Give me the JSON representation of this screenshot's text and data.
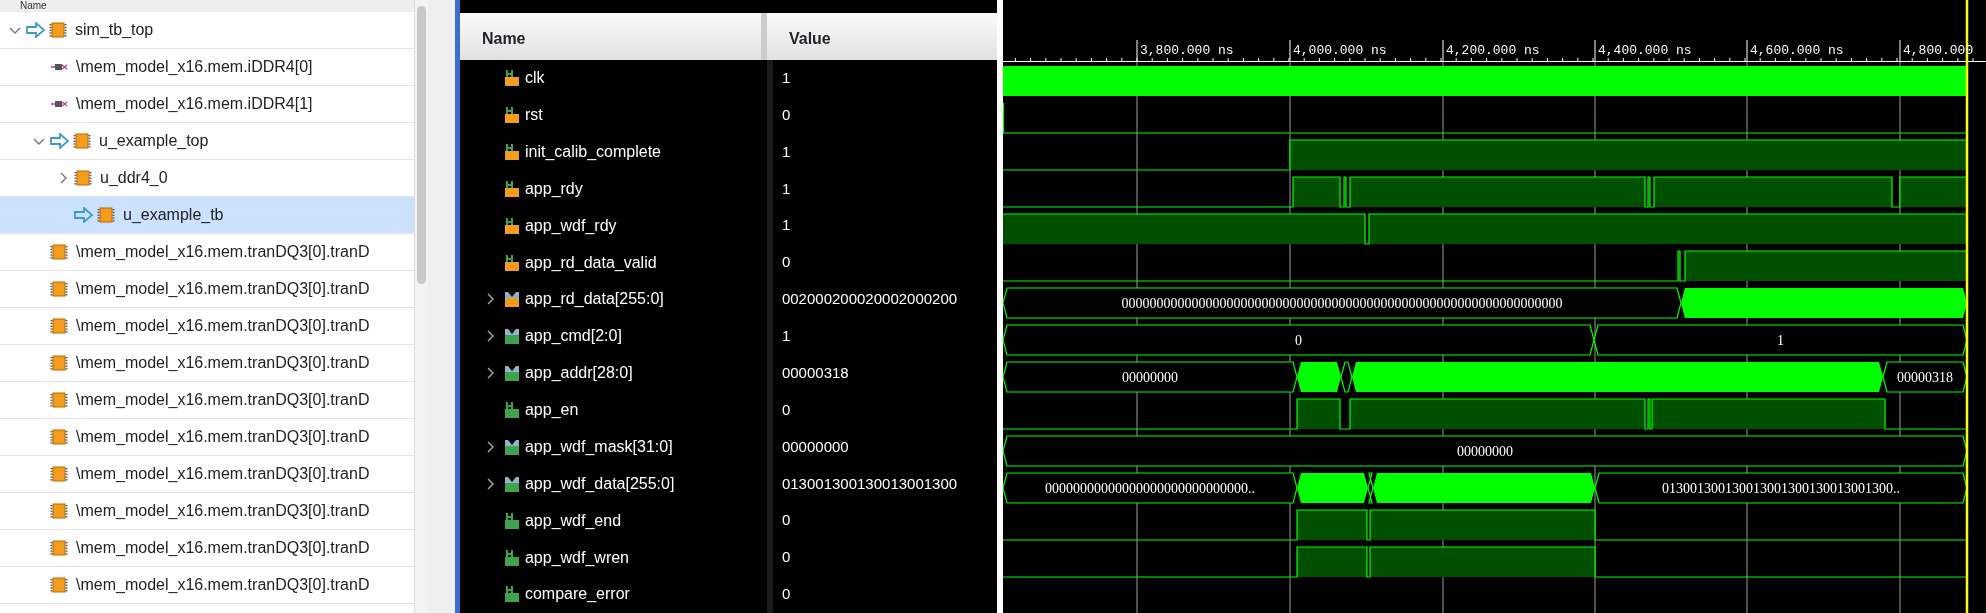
{
  "tree": {
    "header": "Name",
    "items": [
      {
        "label": "sim_tb_top",
        "kind": "module",
        "pointer": true,
        "expanded": true,
        "selected": false,
        "children": [
          {
            "label": "\\mem_model_x16.mem.iDDR4[0]",
            "kind": "primitive",
            "pointer": false,
            "selected": false
          },
          {
            "label": "\\mem_model_x16.mem.iDDR4[1]",
            "kind": "primitive",
            "pointer": false,
            "selected": false
          },
          {
            "label": "u_example_top",
            "kind": "module",
            "pointer": true,
            "expanded": true,
            "selected": false,
            "children": [
              {
                "label": "u_ddr4_0",
                "kind": "module",
                "pointer": false,
                "expanded": false,
                "selected": false
              },
              {
                "label": "u_example_tb",
                "kind": "module",
                "pointer": true,
                "selected": true
              }
            ]
          },
          {
            "label": "\\mem_model_x16.mem.tranDQ3[0].tranD",
            "kind": "module",
            "pointer": false,
            "selected": false
          },
          {
            "label": "\\mem_model_x16.mem.tranDQ3[0].tranD",
            "kind": "module",
            "pointer": false,
            "selected": false
          },
          {
            "label": "\\mem_model_x16.mem.tranDQ3[0].tranD",
            "kind": "module",
            "pointer": false,
            "selected": false
          },
          {
            "label": "\\mem_model_x16.mem.tranDQ3[0].tranD",
            "kind": "module",
            "pointer": false,
            "selected": false
          },
          {
            "label": "\\mem_model_x16.mem.tranDQ3[0].tranD",
            "kind": "module",
            "pointer": false,
            "selected": false
          },
          {
            "label": "\\mem_model_x16.mem.tranDQ3[0].tranD",
            "kind": "module",
            "pointer": false,
            "selected": false
          },
          {
            "label": "\\mem_model_x16.mem.tranDQ3[0].tranD",
            "kind": "module",
            "pointer": false,
            "selected": false
          },
          {
            "label": "\\mem_model_x16.mem.tranDQ3[0].tranD",
            "kind": "module",
            "pointer": false,
            "selected": false
          },
          {
            "label": "\\mem_model_x16.mem.tranDQ3[0].tranD",
            "kind": "module",
            "pointer": false,
            "selected": false
          },
          {
            "label": "\\mem_model_x16.mem.tranDQ3[0].tranD",
            "kind": "module",
            "pointer": false,
            "selected": false
          }
        ]
      }
    ]
  },
  "signals": {
    "columns": [
      "Name",
      "Value"
    ],
    "rows": [
      {
        "name": "clk",
        "value": "1",
        "kind": "bit",
        "color": "#f39c1e"
      },
      {
        "name": "rst",
        "value": "0",
        "kind": "bit",
        "color": "#f39c1e"
      },
      {
        "name": "init_calib_complete",
        "value": "1",
        "kind": "bit",
        "color": "#f39c1e"
      },
      {
        "name": "app_rdy",
        "value": "1",
        "kind": "bit",
        "color": "#f39c1e"
      },
      {
        "name": "app_wdf_rdy",
        "value": "1",
        "kind": "bit",
        "color": "#f39c1e"
      },
      {
        "name": "app_rd_data_valid",
        "value": "0",
        "kind": "bit",
        "color": "#f39c1e"
      },
      {
        "name": "app_rd_data[255:0]",
        "value": "002000200020002000200",
        "kind": "bus",
        "color": "#f39c1e",
        "expanded": false,
        "wave_labels": [
          "000000000000000000000000000000000000000000000000000000000000000"
        ]
      },
      {
        "name": "app_cmd[2:0]",
        "value": "1",
        "kind": "bus",
        "color": "#3fa34d",
        "expanded": false,
        "wave_labels": [
          "0",
          "1"
        ]
      },
      {
        "name": "app_addr[28:0]",
        "value": "00000318",
        "kind": "bus",
        "color": "#3fa34d",
        "expanded": false,
        "wave_labels": [
          "00000000",
          "00000318"
        ]
      },
      {
        "name": "app_en",
        "value": "0",
        "kind": "bit",
        "color": "#3fa34d"
      },
      {
        "name": "app_wdf_mask[31:0]",
        "value": "00000000",
        "kind": "bus",
        "color": "#3fa34d",
        "expanded": false,
        "wave_labels": [
          "00000000"
        ]
      },
      {
        "name": "app_wdf_data[255:0]",
        "value": "013001300130013001300",
        "kind": "bus",
        "color": "#3fa34d",
        "expanded": false,
        "wave_labels": [
          "00000000000000000000000000000..",
          "013001300130013001300130013001300.."
        ]
      },
      {
        "name": "app_wdf_end",
        "value": "0",
        "kind": "bit",
        "color": "#3fa34d"
      },
      {
        "name": "app_wdf_wren",
        "value": "0",
        "kind": "bit",
        "color": "#3fa34d"
      },
      {
        "name": "compare_error",
        "value": "0",
        "kind": "bit",
        "color": "#3fa34d"
      }
    ]
  },
  "waveform": {
    "ruler": [
      "3,800.000 ns",
      "4,000.000 ns",
      "4,200.000 ns",
      "4,400.000 ns",
      "4,600.000 ns",
      "4,800.000"
    ]
  }
}
